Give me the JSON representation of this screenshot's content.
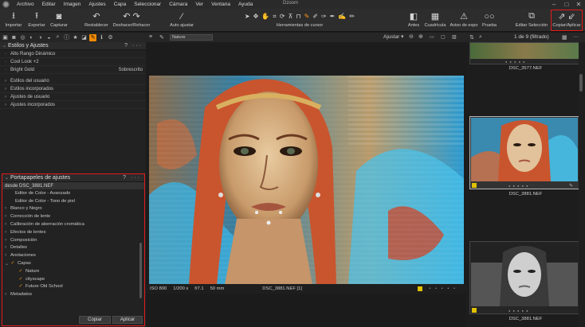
{
  "menu": [
    "Archivo",
    "Editar",
    "Imagen",
    "Ajustes",
    "Capa",
    "Seleccionar",
    "Cámara",
    "Ver",
    "Ventana",
    "Ayuda"
  ],
  "window_title": "Dzoom",
  "toolbar": {
    "importar": "Importar",
    "exportar": "Exportar",
    "capturar": "Capturar",
    "restablecer": "Restablecer",
    "deshacer": "Deshacer/Rehacer",
    "autoajustar": "Auto ajustar",
    "cursor_tools": "Herramientas de cursor",
    "antes": "Antes",
    "cuadricula": "Cuadrícula",
    "aviso": "Aviso de expo",
    "prueba": "Prueba",
    "editar_seleccion": "Editar Selección",
    "copiar_aplicar": "Copiar/Aplicar"
  },
  "viewer": {
    "preset": "Nature",
    "adjust_label": "Ajustar"
  },
  "styles_panel": {
    "title": "Estilos y Ajustes",
    "applied": [
      {
        "label": "Alto Rango Dinámico",
        "value": ""
      },
      {
        "label": "Cool Look +2",
        "value": ""
      },
      {
        "label": "Bright Gold",
        "value": "Sobrescrito"
      }
    ],
    "groups": [
      "Estilos del usuario",
      "Estilos incorporados",
      "Ajustes de usuario",
      "Ajustes incorporados"
    ]
  },
  "clipboard": {
    "title": "Portapapeles de ajustes",
    "source": "desde DSC_3881.NEF",
    "items": [
      {
        "label": "Editor de Color - Avanzado",
        "level": 2,
        "check": false,
        "expander": false
      },
      {
        "label": "Editor de Color - Tono de piel",
        "level": 2,
        "check": false,
        "expander": false
      },
      {
        "label": "Blanco y Negro",
        "level": 0,
        "check": false,
        "expander": true
      },
      {
        "label": "Corrección de lente",
        "level": 0,
        "check": false,
        "expander": true
      },
      {
        "label": "Calibración de aberración cromática",
        "level": 0,
        "check": false,
        "expander": true
      },
      {
        "label": "Efectos de lentes",
        "level": 0,
        "check": false,
        "expander": true
      },
      {
        "label": "Composición",
        "level": 0,
        "check": false,
        "expander": true
      },
      {
        "label": "Detalles",
        "level": 0,
        "check": false,
        "expander": true
      },
      {
        "label": "Anotaciones",
        "level": 0,
        "check": false,
        "expander": true
      },
      {
        "label": "Capas",
        "level": 0,
        "check": true,
        "expander": true
      },
      {
        "label": "Nature",
        "level": 1,
        "check": true,
        "expander": false
      },
      {
        "label": "cityscape",
        "level": 1,
        "check": true,
        "expander": false
      },
      {
        "label": "Future Old School",
        "level": 1,
        "check": true,
        "expander": false
      },
      {
        "label": "Metadatos",
        "level": 0,
        "check": false,
        "expander": true
      }
    ],
    "copy_button": "Copiar",
    "apply_button": "Aplicar"
  },
  "info": {
    "iso": "ISO 800",
    "shutter": "1/200 s",
    "aperture": "f/7.1",
    "focal": "50 mm",
    "filename": "DSC_3881.NEF [1]"
  },
  "browser": {
    "counter": "1 de 9 (filtrado)",
    "thumbs": [
      "DSC_3577.NEF",
      "DSC_3881.NEF",
      "DSC_3881.NEF"
    ]
  },
  "colors": {
    "accent": "#f08a00",
    "highlight": "#e21b1b"
  }
}
